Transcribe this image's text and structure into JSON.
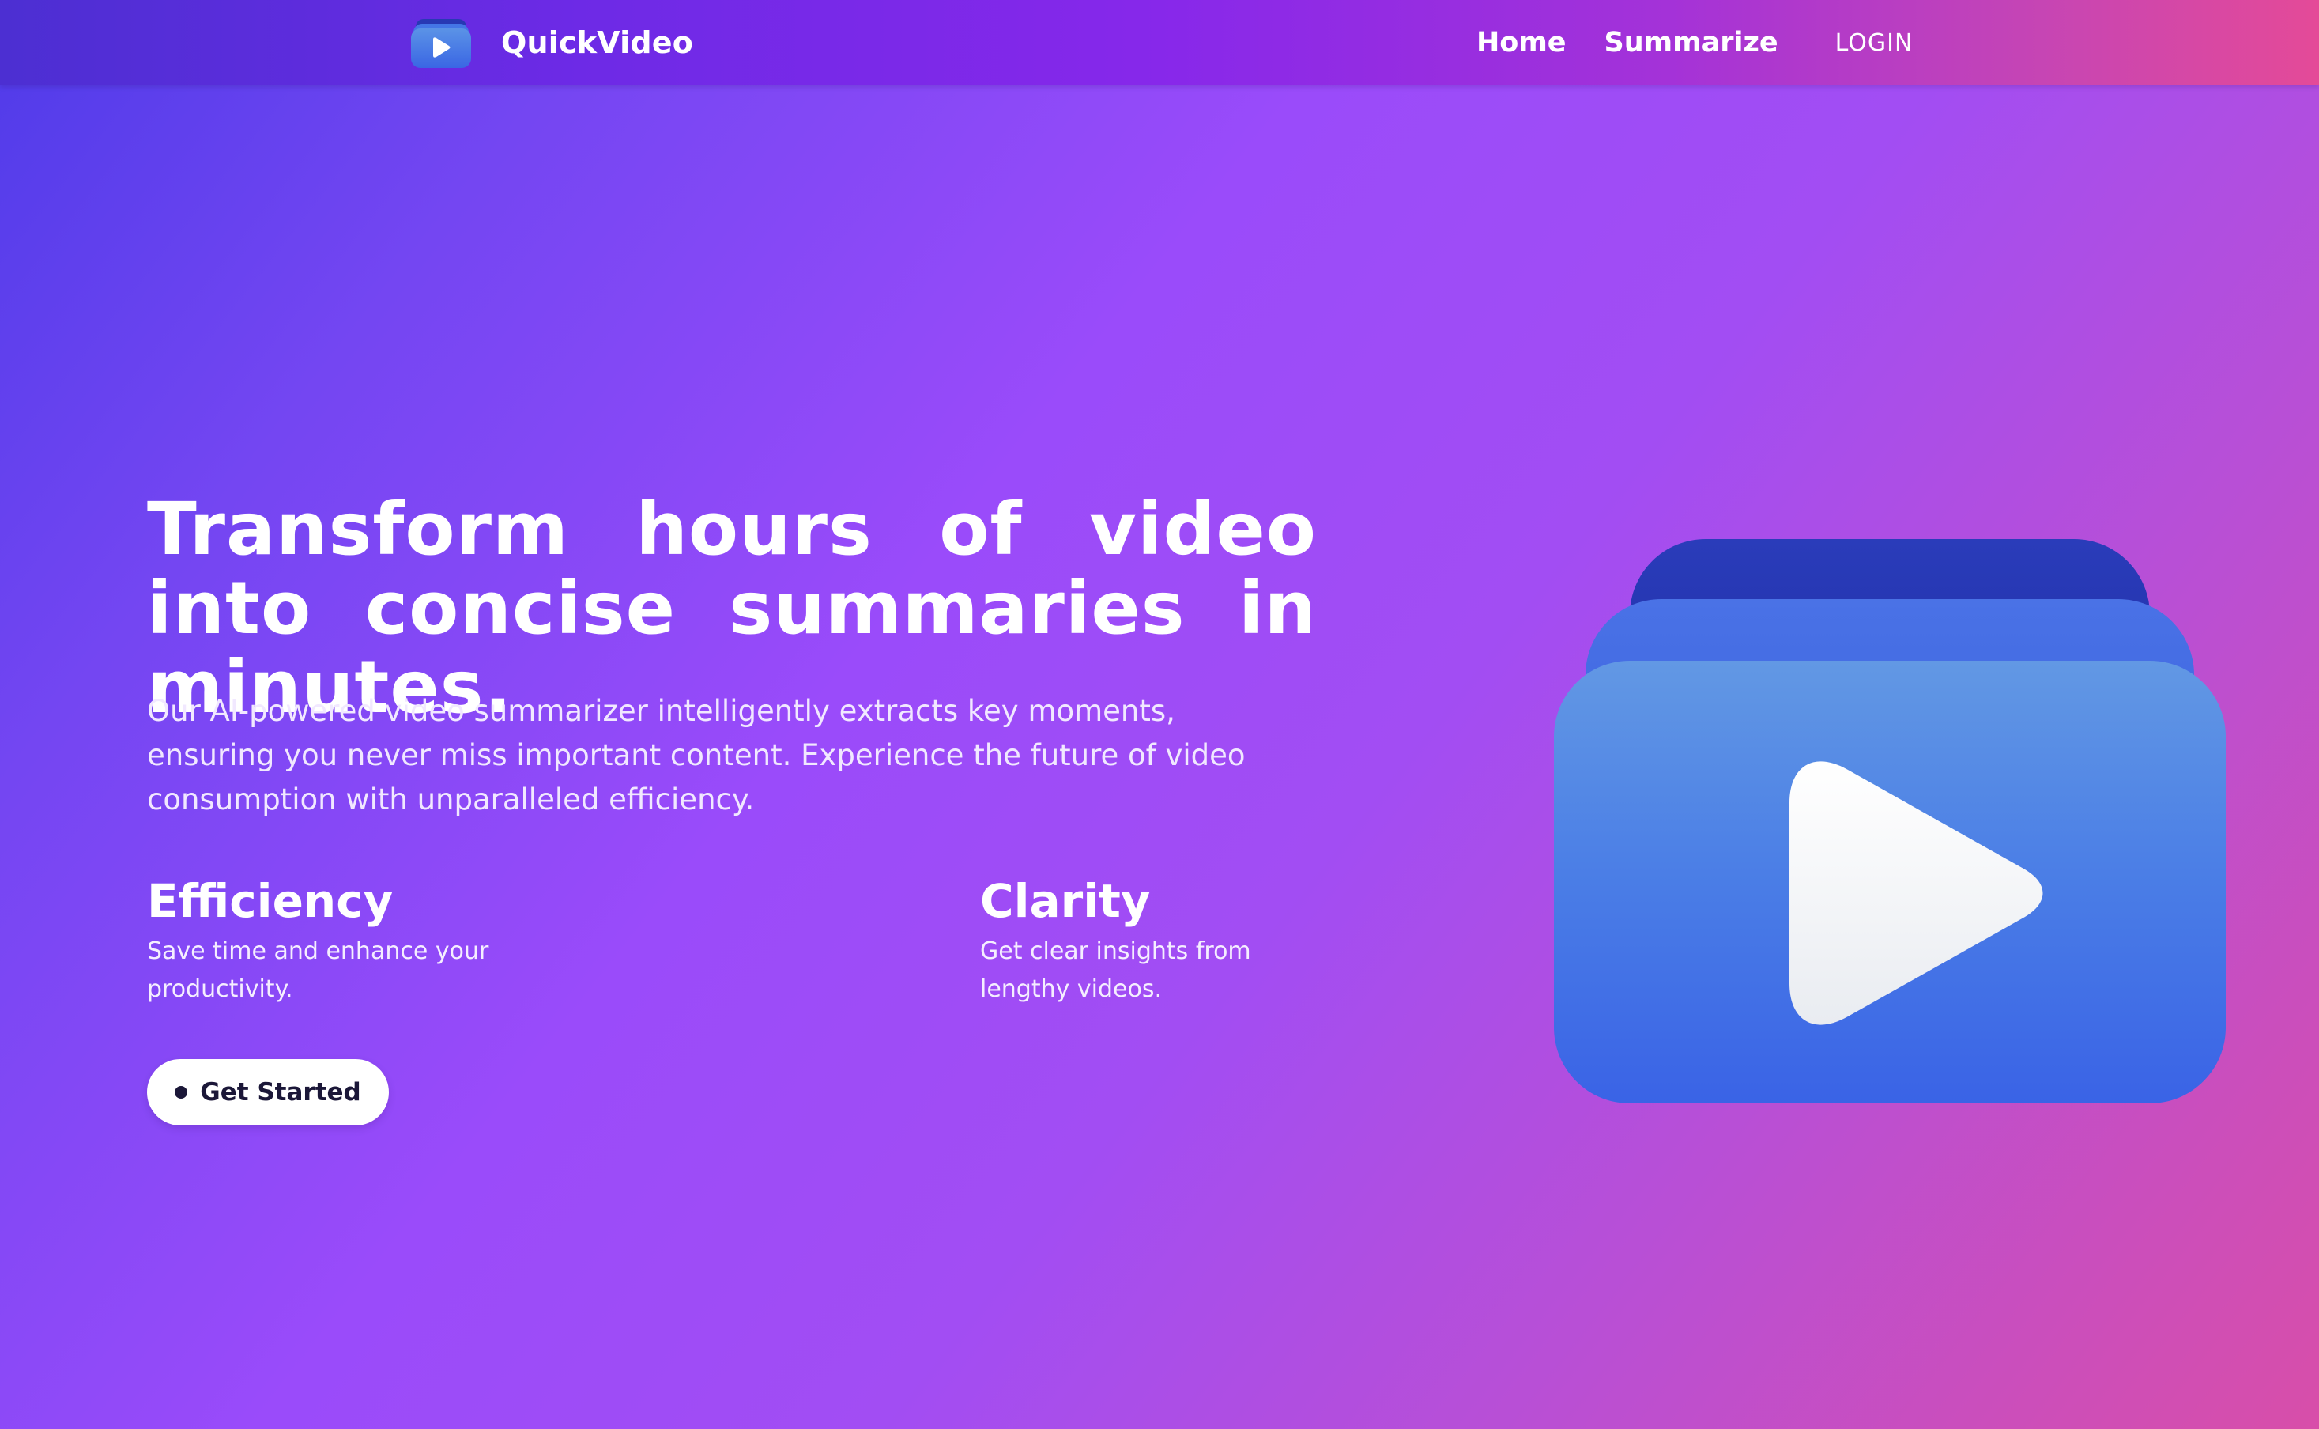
{
  "navbar": {
    "brand": {
      "name": "QuickVideo",
      "logo_icon": "video-play-stack-icon"
    },
    "links": [
      {
        "label": "Home"
      },
      {
        "label": "Summarize"
      },
      {
        "label": "LOGIN"
      }
    ]
  },
  "hero": {
    "title": "Transform hours of video into concise summaries in minutes.",
    "description": "Our AI-powered video summarizer intelligently extracts key moments, ensuring you never miss important content. Experience the future of video consumption with unparalleled efficiency.",
    "features": [
      {
        "title": "Efficiency",
        "text": "Save time and enhance your productivity."
      },
      {
        "title": "Clarity",
        "text": "Get clear insights from lengthy videos."
      }
    ],
    "cta": {
      "label": "Get Started",
      "icon": "dot-icon"
    },
    "illustration_icon": "video-play-stack-icon"
  },
  "colors": {
    "navbar_gradient": [
      "#4c2fd2",
      "#8728ea",
      "#e44a98"
    ],
    "page_gradient": [
      "#4f3be9",
      "#9a4bfa",
      "#d84ea9"
    ],
    "card_blue": "#3a67e6",
    "card_back": "#2636b6",
    "cta_background": "#ffffff",
    "cta_text": "#1b1738"
  }
}
